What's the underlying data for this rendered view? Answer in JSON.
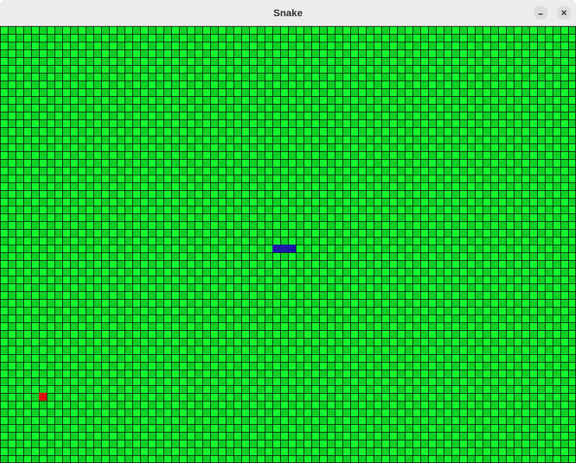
{
  "window": {
    "title": "Snake",
    "minimize_icon": "minimize-icon",
    "close_icon": "close-icon"
  },
  "game": {
    "grid": {
      "columns": 74,
      "rows": 56
    },
    "colors": {
      "cell_light": "#14f52e",
      "cell_dark": "#0fd026",
      "grid_line": "#102010",
      "snake": "#1a1aa8",
      "food": "#e01010"
    },
    "snake": [
      {
        "col": 35,
        "row": 28
      },
      {
        "col": 36,
        "row": 28
      },
      {
        "col": 37,
        "row": 28
      }
    ],
    "food": {
      "col": 5,
      "row": 47
    }
  }
}
